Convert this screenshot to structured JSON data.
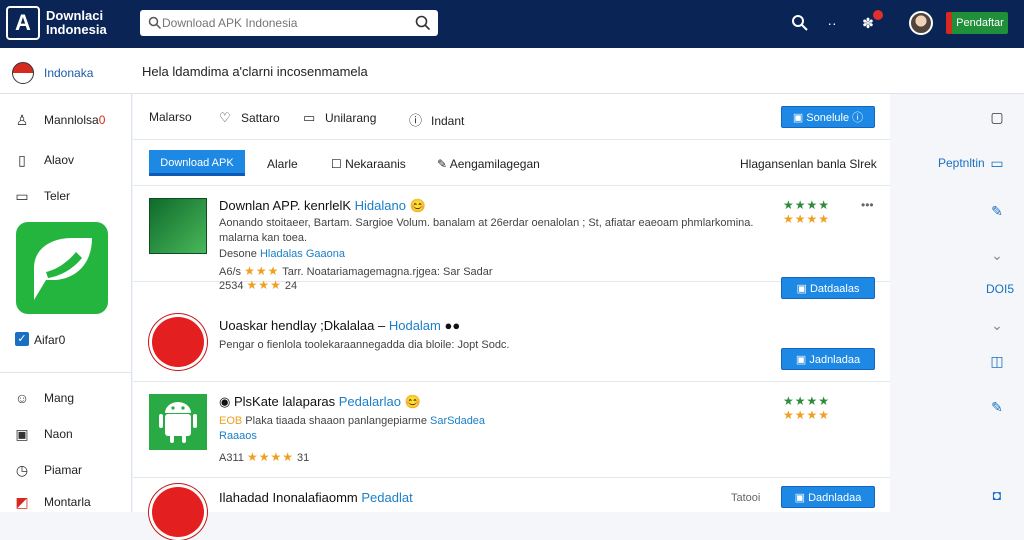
{
  "header": {
    "logo_letter": "A",
    "brand_line1": "Downlaci",
    "brand_line2": "Indonesia",
    "search_placeholder": "Download APK Indonesia",
    "register_label": "Pendaftar"
  },
  "subbar": {
    "region": "Indonaka",
    "welcome": "Hela ldamdima a'clarni incosenmamela"
  },
  "sidebar": {
    "items": [
      {
        "label": "Mannlolsa"
      },
      {
        "label": "Alaov"
      },
      {
        "label": "Teler"
      },
      {
        "label": "Mang"
      },
      {
        "label": "Naon"
      },
      {
        "label": "Piamar"
      },
      {
        "label": "Montarla"
      }
    ],
    "item_badge": "0",
    "checkbox_label": "Aifar0"
  },
  "toolbar": {
    "items": [
      "Malarso",
      "Sattaro",
      "Unilarang",
      "Indant"
    ],
    "action_button": "Sonelule"
  },
  "tabs": {
    "active": "Download APK",
    "items": [
      "Alarle",
      "Nekaraanis",
      "Aengamilagegan"
    ],
    "sort_label": "Hlagansenlan banla Slrek"
  },
  "rows": [
    {
      "title": "Downlan APP. kenrlelK",
      "publisher": "Hidalano",
      "desc": "Aonando stoitaeer, Bartam. Sargioe Volum. banalam at 26erdar oenalolan ; St, afiatar eaeoam phmlarkomina. malarna kan toea.",
      "dev_label": "Desone",
      "dev_link": "Hladalas Gaaona",
      "rating1_label": "A6/s",
      "rating1_text": "Tarr. Noatariamagemagna.rjgea: Sar Sadar",
      "rating2_label": "2534",
      "rating2_value": "24",
      "side_stars": "★★★★",
      "side_stars2": "★★★★",
      "more": "•••"
    },
    {
      "title": "Uoaskar hendlay ;Dkalalaa –",
      "publisher": "Hodalam",
      "desc": "Pengar o fienlola toolekaraannegadda dia bloile: Jopt Sodc.",
      "button": "Jadnladaa"
    },
    {
      "title": "PlsKate lalaparas",
      "publisher": "Pedalarlao",
      "desc_prefix": "EOB",
      "desc": "Plaka tiaada shaaon panlangepiarme",
      "desc_link": "SarSdadea",
      "dev_link": "Raaaos",
      "rating_label": "A311",
      "rating_value": "31",
      "side_stars": "★★★★",
      "side_stars2": "★★★★"
    },
    {
      "title": "Ilahadad Inonalafiaomm",
      "publisher": "Pedadlat",
      "meta": "Tatooi",
      "button": "Dadnladaa"
    }
  ],
  "row1_button": "Datdaalas",
  "rightbar": {
    "label1": "Peptnltin",
    "label2": "DOI5"
  }
}
